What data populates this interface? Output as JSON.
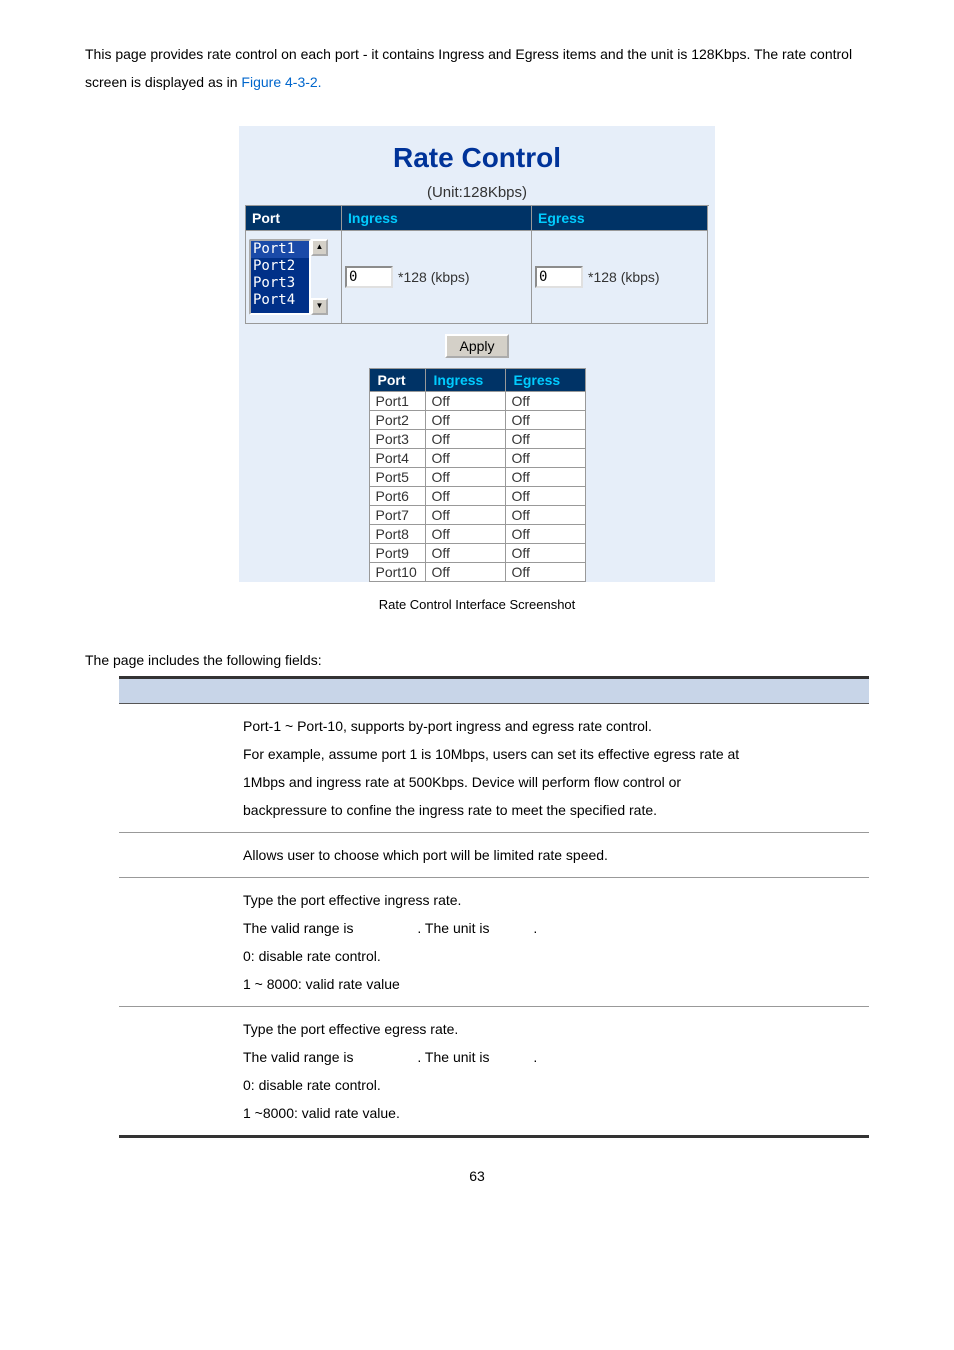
{
  "intro": {
    "part1": "This page provides rate control on each port - it contains Ingress and Egress items and the unit is 128Kbps. The rate control screen is displayed as in ",
    "link": "Figure 4-3-2."
  },
  "rate_control": {
    "title": "Rate Control",
    "unit_label": "(Unit:128Kbps)",
    "headers": {
      "port": "Port",
      "ingress": "Ingress",
      "egress": "Egress"
    },
    "port_options": [
      "Port1",
      "Port2",
      "Port3",
      "Port4"
    ],
    "ingress_value": "0",
    "ingress_unit": "*128 (kbps)",
    "egress_value": "0",
    "egress_unit": "*128 (kbps)",
    "apply_label": "Apply",
    "status": [
      {
        "port": "Port1",
        "ingress": "Off",
        "egress": "Off"
      },
      {
        "port": "Port2",
        "ingress": "Off",
        "egress": "Off"
      },
      {
        "port": "Port3",
        "ingress": "Off",
        "egress": "Off"
      },
      {
        "port": "Port4",
        "ingress": "Off",
        "egress": "Off"
      },
      {
        "port": "Port5",
        "ingress": "Off",
        "egress": "Off"
      },
      {
        "port": "Port6",
        "ingress": "Off",
        "egress": "Off"
      },
      {
        "port": "Port7",
        "ingress": "Off",
        "egress": "Off"
      },
      {
        "port": "Port8",
        "ingress": "Off",
        "egress": "Off"
      },
      {
        "port": "Port9",
        "ingress": "Off",
        "egress": "Off"
      },
      {
        "port": "Port10",
        "ingress": "Off",
        "egress": "Off"
      }
    ]
  },
  "caption": "Rate Control Interface Screenshot",
  "fields_intro": "The page includes the following fields:",
  "desc": {
    "row1_l1": "Port-1 ~ Port-10, supports by-port ingress and egress rate control.",
    "row1_l2": "For example, assume port 1 is 10Mbps, users can set its effective egress rate at",
    "row1_l3": "1Mbps and ingress rate at 500Kbps. Device will perform flow control or",
    "row1_l4": "backpressure to confine the ingress rate to meet the specified rate.",
    "row_port": "Allows user to choose which port will be limited rate speed.",
    "row_ing_1": "Type the port effective ingress rate.",
    "row_ing_2a": "The valid range is ",
    "row_ing_2b": ". The unit is ",
    "row_ing_2c": ".",
    "row_ing_3": "0: disable rate control.",
    "row_ing_4": "1 ~ 8000: valid rate value",
    "row_eg_1": "Type the port effective egress rate.",
    "row_eg_2a": "The valid range is ",
    "row_eg_2b": ". The unit is ",
    "row_eg_2c": ".",
    "row_eg_3": "0: disable rate control.",
    "row_eg_4": "1 ~8000: valid rate value."
  },
  "pagenum": "63"
}
